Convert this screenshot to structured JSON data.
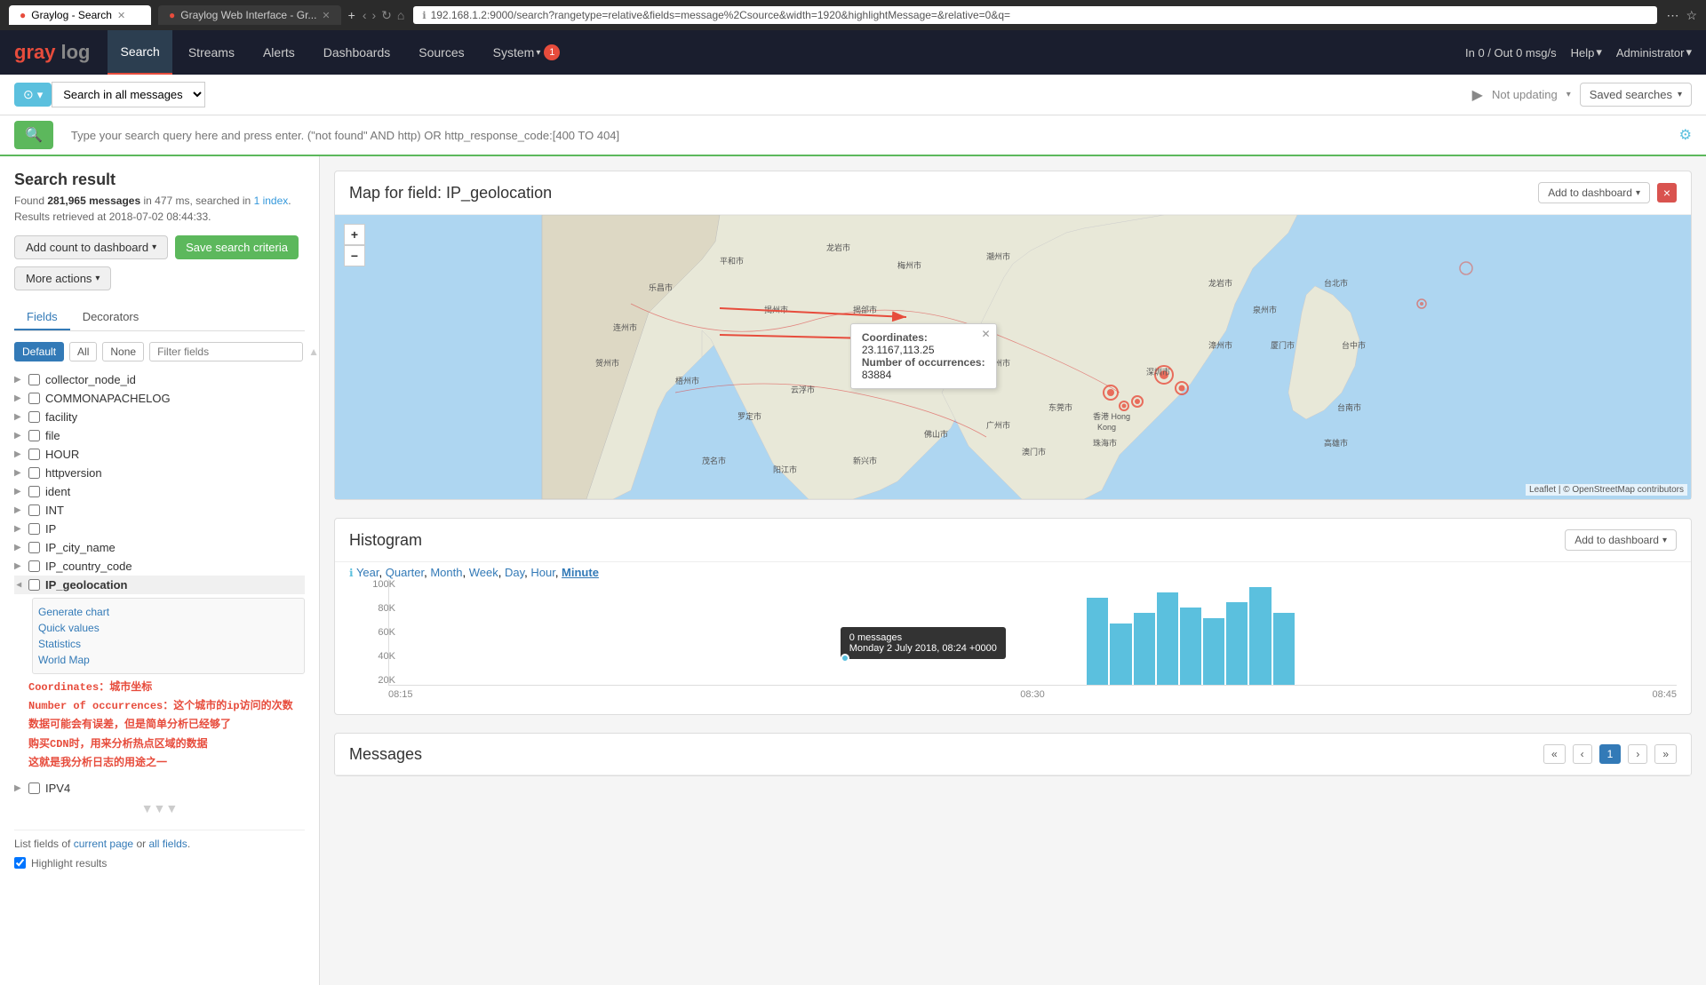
{
  "browser": {
    "tab_active": "Graylog - Search",
    "tab_inactive": "Graylog Web Interface - Gr...",
    "url": "192.168.1.2:9000/search?rangetype=relative&fields=message%2Csource&width=1920&highlightMessage=&relative=0&q="
  },
  "navbar": {
    "brand": "graylog",
    "items": [
      "Search",
      "Streams",
      "Alerts",
      "Dashboards",
      "Sources",
      "System"
    ],
    "system_badge": "1",
    "right_info": "In 0 / Out 0 msg/s",
    "help": "Help",
    "admin": "Administrator"
  },
  "search_toolbar": {
    "scope_label": "Search in all messages",
    "query_placeholder": "Type your search query here and press enter. (\"not found\" AND http) OR http_response_code:[400 TO 404]",
    "query_value": "Type your search query here and press enter. (\"not found\" AND http) OR http_response_code:[400 TO 404]",
    "not_updating": "Not updating",
    "saved_searches": "Saved searches"
  },
  "sidebar": {
    "title": "Search result",
    "found_label": "Found",
    "found_count": "281,965 messages",
    "found_detail": "in 477 ms, searched in",
    "index_link": "1 index",
    "retrieved_label": "Results retrieved at 2018-07-02 08:44:33.",
    "buttons": {
      "add_count": "Add count to dashboard",
      "save_search": "Save search criteria",
      "more_actions": "More actions"
    },
    "tabs": [
      "Fields",
      "Decorators"
    ],
    "filter_buttons": [
      "Default",
      "All",
      "None"
    ],
    "filter_placeholder": "Filter fields",
    "fields": [
      {
        "name": "collector_node_id",
        "expanded": false
      },
      {
        "name": "COMMONAPACHELOG",
        "expanded": false
      },
      {
        "name": "facility",
        "expanded": false
      },
      {
        "name": "file",
        "expanded": false
      },
      {
        "name": "HOUR",
        "expanded": false
      },
      {
        "name": "httpversion",
        "expanded": false
      },
      {
        "name": "ident",
        "expanded": false
      },
      {
        "name": "INT",
        "expanded": false
      },
      {
        "name": "IP",
        "expanded": false
      },
      {
        "name": "IP_city_name",
        "expanded": false
      },
      {
        "name": "IP_country_code",
        "expanded": false
      },
      {
        "name": "IP_geolocation",
        "expanded": true
      }
    ],
    "ip_geo_actions": [
      "Generate chart",
      "Quick values",
      "Statistics",
      "World Map"
    ],
    "more_fields": [
      "IPV4"
    ],
    "footer_text": "List fields of",
    "footer_link1": "current page",
    "footer_link2": "all fields",
    "highlight_label": "Highlight results"
  },
  "map_widget": {
    "title": "Map for field: IP_geolocation",
    "add_dashboard_label": "Add to dashboard",
    "close_label": "×",
    "tooltip": {
      "coordinates_label": "Coordinates:",
      "coordinates_value": "23.1167,113.25",
      "occurrences_label": "Number of occurrences:",
      "occurrences_value": "83884"
    },
    "attribution": "Leaflet | © OpenStreetMap contributors",
    "zoom_in": "+",
    "zoom_out": "−"
  },
  "annotations": {
    "coordinates_label": "Coordinates：城市坐标",
    "occurrences_label": "Number of occurrences：这个城市的ip访问的次数",
    "note1": "数据可能会有误差，但是简单分析已经够了",
    "note2": "购买CDN时，用来分析热点区域的数据",
    "note3": "这就是我分析日志的用途之一"
  },
  "histogram": {
    "title": "Histogram",
    "time_options": [
      "Year",
      "Quarter",
      "Month",
      "Week",
      "Day",
      "Hour",
      "Minute"
    ],
    "active_time": "Minute",
    "y_labels": [
      "100K",
      "80K",
      "60K",
      "40K",
      "20K"
    ],
    "x_labels": [
      "08:15",
      "08:30",
      "08:45"
    ],
    "add_dashboard_label": "Add to dashboard",
    "tooltip_messages": "0 messages",
    "tooltip_time": "Monday 2 July 2018, 08:24 +0000",
    "bars": [
      0,
      0,
      0,
      0,
      0,
      0,
      0,
      0,
      0,
      0,
      0,
      0,
      0,
      0,
      0,
      0,
      0,
      0,
      0,
      0,
      0,
      0,
      0,
      0,
      0,
      0,
      0,
      0,
      0,
      0,
      85,
      60,
      70,
      90,
      75,
      65,
      80,
      95,
      70
    ]
  },
  "messages_section": {
    "title": "Messages",
    "page_buttons": [
      "«",
      "‹",
      "1",
      "›",
      "»"
    ]
  }
}
